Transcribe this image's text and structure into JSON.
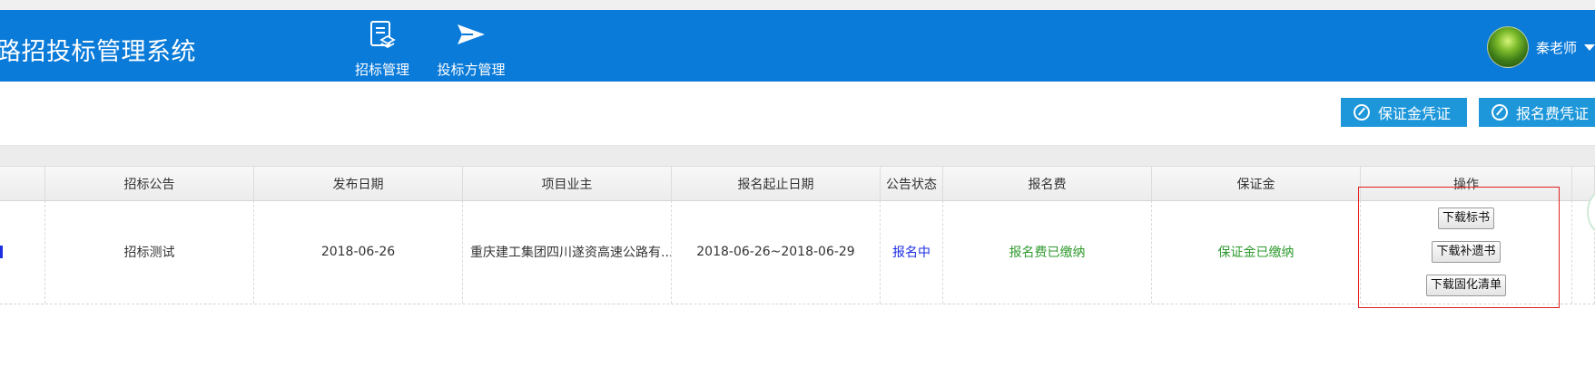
{
  "header": {
    "app_title": "路招投标管理系统",
    "nav": [
      {
        "label": "招标管理",
        "icon": "document-stack-icon"
      },
      {
        "label": "投标方管理",
        "icon": "send-icon"
      }
    ],
    "user": {
      "name": "秦老师",
      "avatar_icon": "avatar"
    }
  },
  "toolbar": {
    "deposit_label": "保证金凭证",
    "fee_label": "报名费凭证",
    "button_color": "#1d97da"
  },
  "table": {
    "headers": [
      "",
      "招标公告",
      "发布日期",
      "项目业主",
      "报名起止日期",
      "公告状态",
      "报名费",
      "保证金",
      "操作",
      ""
    ],
    "rows": [
      {
        "notice": "招标测试",
        "publish_date": "2018-06-26",
        "owner": "重庆建工集团四川遂资高速公路有...",
        "signup_period": "2018-06-26~2018-06-29",
        "status": "报名中",
        "fee": "报名费已缴纳",
        "deposit": "保证金已缴纳",
        "actions": [
          "下载标书",
          "下载补遗书",
          "下载固化清单"
        ]
      }
    ]
  },
  "colors": {
    "header_bg": "#0b7bd9",
    "status_blue": "#1c2fe0",
    "paid_green": "#2e9a2e",
    "highlight_red": "#e02020"
  }
}
